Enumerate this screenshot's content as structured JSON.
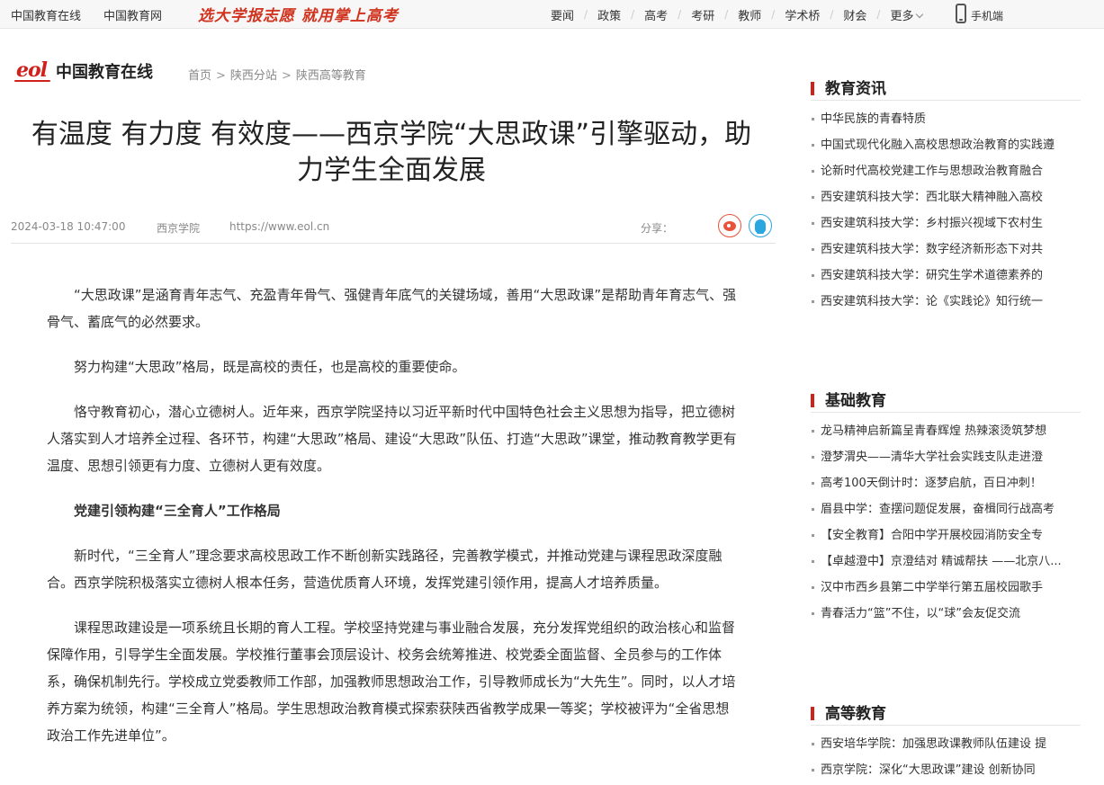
{
  "topbar": {
    "site_links": [
      "中国教育在线",
      "中国教育网"
    ],
    "slogan": "选大学报志愿 就用掌上高考",
    "nav": [
      "要闻",
      "政策",
      "高考",
      "考研",
      "教师",
      "学术桥",
      "财会"
    ],
    "more": "更多",
    "mobile": "手机端"
  },
  "header": {
    "logo_mark": "eol",
    "logo_text": "中国教育在线",
    "breadcrumb": [
      "首页",
      "陕西分站",
      "陕西高等教育"
    ],
    "breadcrumb_sep": ">"
  },
  "article": {
    "title": "有温度 有力度 有效度——西京学院“大思政课”引擎驱动，助力学生全面发展",
    "date": "2024-03-18 10:47:00",
    "source": "西京学院",
    "url": "https://www.eol.cn",
    "share_label": "分享：",
    "paragraphs": [
      "“大思政课”是涵育青年志气、充盈青年骨气、强健青年底气的关键场域，善用“大思政课”是帮助青年育志气、强骨气、蓄底气的必然要求。",
      "努力构建“大思政”格局，既是高校的责任，也是高校的重要使命。",
      "恪守教育初心，潜心立德树人。近年来，西京学院坚持以习近平新时代中国特色社会主义思想为指导，把立德树人落实到人才培养全过程、各环节，构建“大思政”格局、建设“大思政”队伍、打造“大思政”课堂，推动教育教学更有温度、思想引领更有力度、立德树人更有效度。",
      "党建引领构建“三全育人”工作格局",
      "新时代，“三全育人”理念要求高校思政工作不断创新实践路径，完善教学模式，并推动党建与课程思政深度融合。西京学院积极落实立德树人根本任务，营造优质育人环境，发挥党建引领作用，提高人才培养质量。",
      "课程思政建设是一项系统且长期的育人工程。学校坚持党建与事业融合发展，充分发挥党组织的政治核心和监督保障作用，引导学生全面发展。学校推行董事会顶层设计、校务会统筹推进、校党委全面监督、全员参与的工作体系，确保机制先行。学校成立党委教师工作部，加强教师思想政治工作，引导教师成长为“大先生”。同时，以人才培养方案为统领，构建“三全育人”格局。学生思想政治教育模式探索获陕西省教学成果一等奖；学校被评为“全省思想政治工作先进单位”。"
    ]
  },
  "sidebar": [
    {
      "title": "教育资讯",
      "items": [
        "中华民族的青春特质",
        "中国式现代化融入高校思想政治教育的实践遵",
        "论新时代高校党建工作与思想政治教育融合",
        "西安建筑科技大学：西北联大精神融入高校",
        "西安建筑科技大学：乡村振兴视域下农村生",
        "西安建筑科技大学：数字经济新形态下对共",
        "西安建筑科技大学：研究生学术道德素养的",
        "西安建筑科技大学：论《实践论》知行统一"
      ]
    },
    {
      "title": "基础教育",
      "items": [
        "龙马精神启新篇呈青春辉煌 热辣滚烫筑梦想",
        "澄梦渭央——清华大学社会实践支队走进澄",
        "高考100天倒计时：逐梦启航，百日冲刺！",
        "眉县中学：查摆问题促发展，奋楫同行战高考",
        "【安全教育】合阳中学开展校园消防安全专",
        "【卓越澄中】京澄结对 精诚帮扶 ——北京八...",
        "汉中市西乡县第二中学举行第五届校园歌手",
        "青春活力“篮”不住，以“球”会友促交流"
      ]
    },
    {
      "title": "高等教育",
      "items": [
        "西安培华学院：加强思政课教师队伍建设 提",
        "西京学院：深化“大思政课”建设 创新协同"
      ]
    }
  ],
  "colors": {
    "brand_red": "#d0221d",
    "weibo": "#e8543a",
    "qq": "#2aa6e0"
  }
}
